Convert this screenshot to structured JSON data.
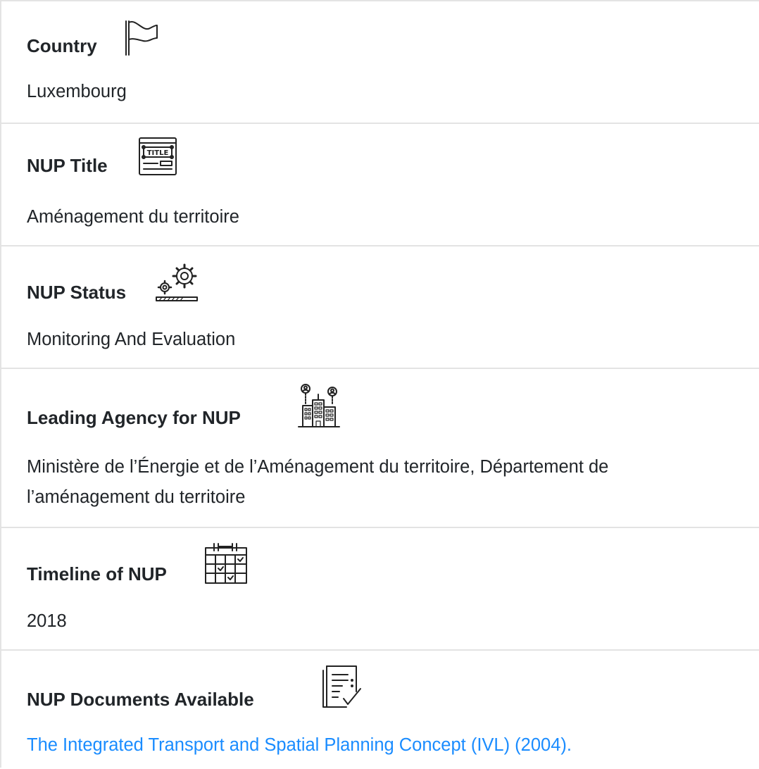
{
  "fields": [
    {
      "label": "Country",
      "icon": "flag-icon",
      "value": "Luxembourg"
    },
    {
      "label": "NUP Title",
      "icon": "title-icon",
      "icon_text": "TITLE",
      "value": "Aménagement du territoire"
    },
    {
      "label": "NUP Status",
      "icon": "gears-progress-icon",
      "value": "Monitoring And Evaluation"
    },
    {
      "label": "Leading Agency for NUP",
      "icon": "city-agency-icon",
      "value": "Ministère de l’Énergie et de l’Aménagement du territoire, Département de l’aménagement du territoire"
    },
    {
      "label": "Timeline of NUP",
      "icon": "calendar-icon",
      "value": "2018"
    },
    {
      "label": "NUP Documents Available",
      "icon": "document-check-icon",
      "value": "The Integrated Transport and Spatial Planning Concept (IVL) (2004).",
      "is_link": true
    }
  ],
  "colors": {
    "text": "#212529",
    "link": "#1a8cff",
    "border": "#e3e3e3"
  }
}
